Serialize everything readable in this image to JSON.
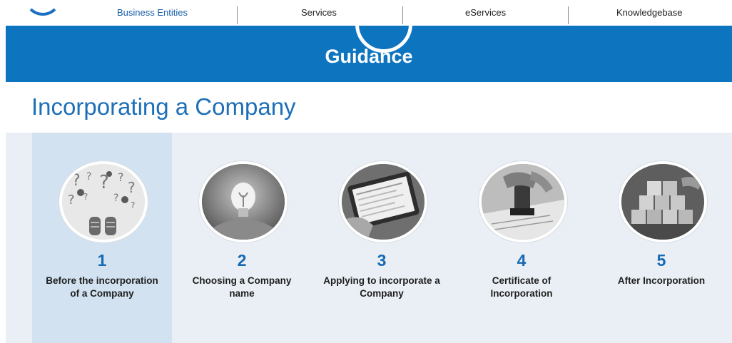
{
  "nav": {
    "items": [
      {
        "label": "Business Entities",
        "active": true
      },
      {
        "label": "Services",
        "active": false
      },
      {
        "label": "eServices",
        "active": false
      },
      {
        "label": "Knowledgebase",
        "active": false
      }
    ]
  },
  "banner": {
    "title": "Guidance",
    "color": "#0d74c0"
  },
  "page": {
    "title": "Incorporating a Company"
  },
  "steps": [
    {
      "number": "1",
      "label": "Before the incorporation of a Company",
      "image": "question-marks-and-shoes",
      "active": true
    },
    {
      "number": "2",
      "label": "Choosing a Company name",
      "image": "lightbulb-in-hands",
      "active": false
    },
    {
      "number": "3",
      "label": "Applying to incorporate a Company",
      "image": "tablet-form",
      "active": false
    },
    {
      "number": "4",
      "label": "Certificate of Incorporation",
      "image": "stamp-on-document",
      "active": false
    },
    {
      "number": "5",
      "label": "After Incorporation",
      "image": "stacked-blocks",
      "active": false
    }
  ],
  "colors": {
    "accent": "#1c6fb8",
    "panel": "#e9eff4",
    "active_step": "#d2e2f0"
  }
}
